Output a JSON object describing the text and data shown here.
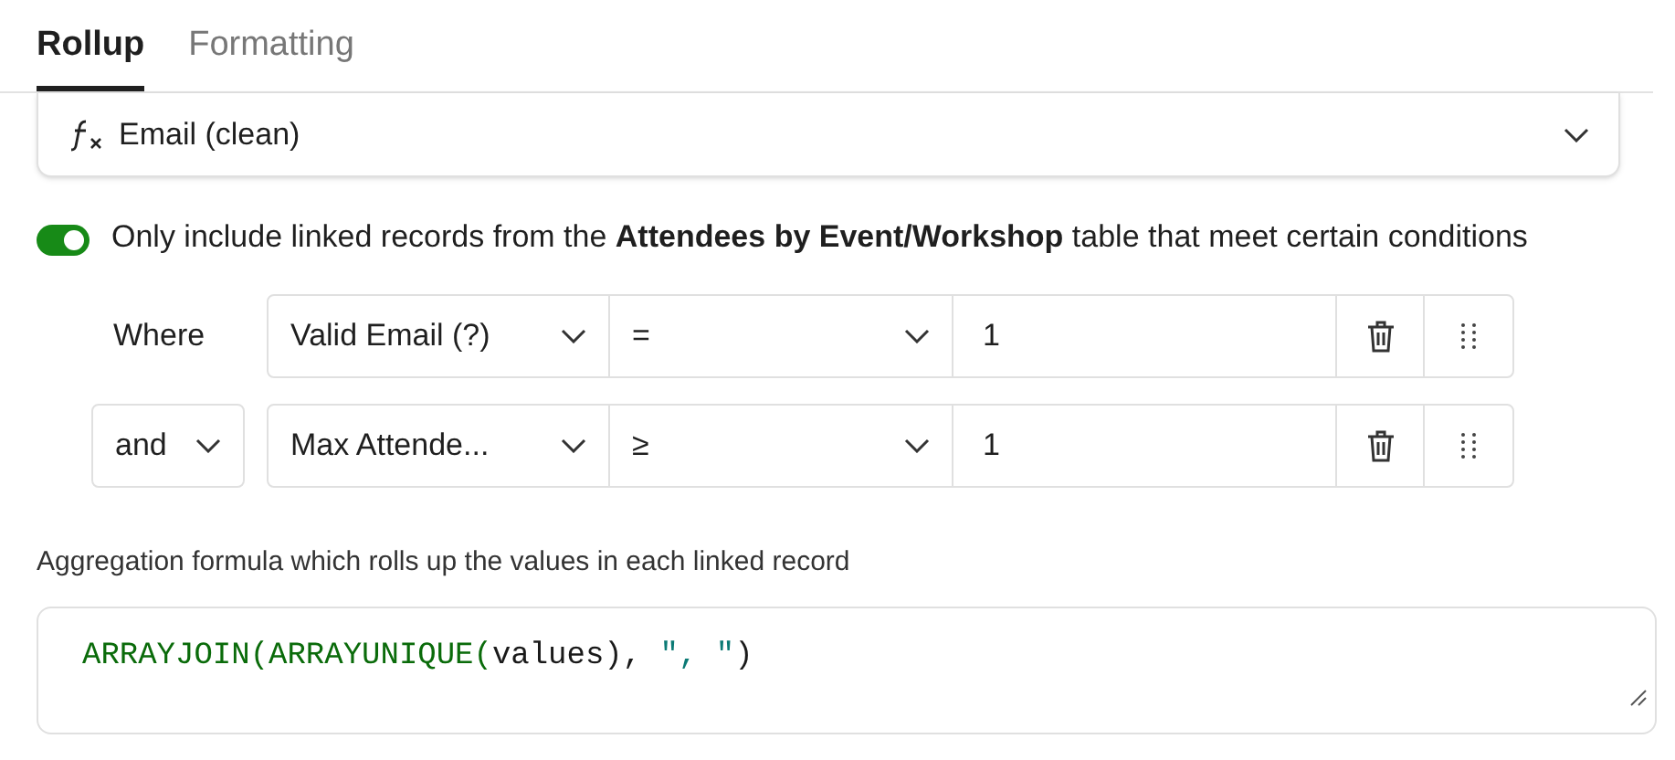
{
  "tabs": [
    {
      "label": "Rollup",
      "selected": true
    },
    {
      "label": "Formatting",
      "selected": false
    }
  ],
  "field": {
    "value": "Email (clean)"
  },
  "filter_toggle": {
    "on": true,
    "text": "Only include linked records from the **Attendees by Event/Workshop** table that meet certain conditions"
  },
  "conditions": [
    {
      "conjunction": "Where",
      "conjunction_is_dropdown": false,
      "field": "Valid Email (?)",
      "operator": "=",
      "value": "1"
    },
    {
      "conjunction": "and",
      "conjunction_is_dropdown": true,
      "field": "Max Attende...",
      "operator": "≥",
      "value": "1"
    }
  ],
  "formula": {
    "label": "Aggregation formula which rolls up the values in each linked record",
    "tokens": [
      {
        "text": "ARRAYJOIN(",
        "kind": "function"
      },
      {
        "text": "ARRAYUNIQUE(",
        "kind": "function"
      },
      {
        "text": "values",
        "kind": "plain"
      },
      {
        "text": "), ",
        "kind": "plain"
      },
      {
        "text": "\", \"",
        "kind": "string"
      },
      {
        "text": ")",
        "kind": "plain"
      }
    ]
  }
}
